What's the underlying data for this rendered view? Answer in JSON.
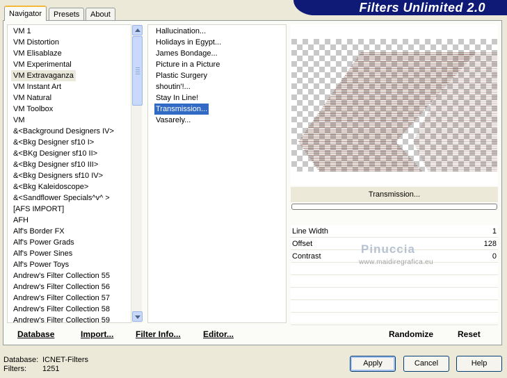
{
  "window": {
    "title": "Filters Unlimited 2.0"
  },
  "tabs": [
    {
      "label": "Navigator",
      "active": true
    },
    {
      "label": "Presets",
      "active": false
    },
    {
      "label": "About",
      "active": false
    }
  ],
  "categories": {
    "selected_index": 4,
    "items": [
      "VM 1",
      "VM Distortion",
      "VM Elisablaze",
      "VM Experimental",
      "VM Extravaganza",
      "VM Instant Art",
      "VM Natural",
      "VM Toolbox",
      "VM",
      "&<Background Designers IV>",
      "&<Bkg Designer sf10 I>",
      "&<BKg Designer sf10 II>",
      "&<Bkg Designer sf10 III>",
      "&<Bkg Designers sf10 IV>",
      "&<Bkg Kaleidoscope>",
      "&<Sandflower Specials^v^ >",
      "[AFS IMPORT]",
      "AFH",
      "Alf's Border FX",
      "Alf's Power Grads",
      "Alf's Power Sines",
      "Alf's Power Toys",
      "Andrew's Filter Collection 55",
      "Andrew's Filter Collection 56",
      "Andrew's Filter Collection 57",
      "Andrew's Filter Collection 58",
      "Andrew's Filter Collection 59"
    ]
  },
  "filters": {
    "selected_index": 7,
    "items": [
      "Hallucination...",
      "Holidays in Egypt...",
      "James Bondage...",
      "Picture in a Picture",
      "Plastic Surgery",
      "shoutin'!...",
      "Stay In Line!",
      "Transmission...",
      "Vasarely..."
    ]
  },
  "preview": {
    "filter_name": "Transmission..."
  },
  "parameters": [
    {
      "label": "Line Width",
      "value": "1"
    },
    {
      "label": "Offset",
      "value": "128"
    },
    {
      "label": "Contrast",
      "value": "0"
    }
  ],
  "watermark": {
    "name": "Pinuccia",
    "url": "www.maidiregrafica.eu"
  },
  "toolbar": {
    "database": "Database",
    "import": "Import...",
    "filter_info": "Filter Info...",
    "editor": "Editor...",
    "randomize": "Randomize",
    "reset": "Reset"
  },
  "status": {
    "database_label": "Database:",
    "database_value": "ICNET-Filters",
    "filters_label": "Filters:",
    "filters_value": "1251"
  },
  "buttons": {
    "apply": "Apply",
    "cancel": "Cancel",
    "help": "Help"
  }
}
